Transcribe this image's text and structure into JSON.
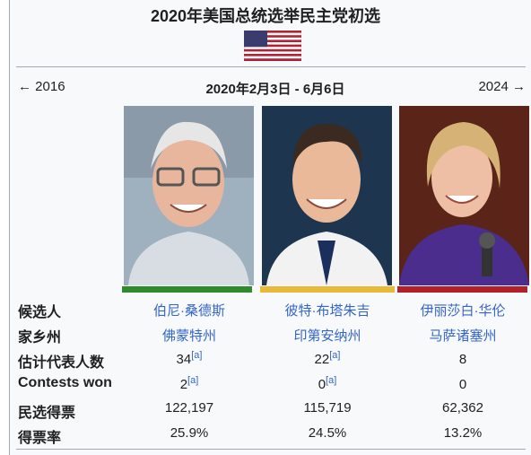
{
  "title": "2020年美国总统选举民主党初选",
  "nav": {
    "prev": "← 2016",
    "date": "2020年2月3日 - 6月6日",
    "next": "2024 →"
  },
  "flag_icon": "us-flag-icon",
  "row_labels": {
    "candidate": "候选人",
    "home_state": "家乡州",
    "delegates": "估计代表人数",
    "contests_won": "Contests won",
    "popular_vote": "民选得票",
    "percentage": "得票率"
  },
  "candidates": [
    {
      "name": "伯尼·桑德斯",
      "home_state": "佛蒙特州",
      "delegates": "34",
      "delegates_note": "[a]",
      "contests_won": "2",
      "contests_note": "[a]",
      "popular_vote": "122,197",
      "percentage": "25.9%",
      "color": "#2e8b2e"
    },
    {
      "name": "彼特·布塔朱吉",
      "home_state": "印第安纳州",
      "delegates": "22",
      "delegates_note": "[a]",
      "contests_won": "0",
      "contests_note": "[a]",
      "popular_vote": "115,719",
      "percentage": "24.5%",
      "color": "#e9b93a"
    },
    {
      "name": "伊丽莎白·华伦",
      "home_state": "马萨诸塞州",
      "delegates": "8",
      "delegates_note": "",
      "contests_won": "0",
      "contests_note": "",
      "popular_vote": "62,362",
      "percentage": "13.2%",
      "color": "#b2202a"
    }
  ],
  "colors": {
    "link": "#3366cc",
    "border": "#a2a9b1",
    "background": "#f8f9fa"
  }
}
